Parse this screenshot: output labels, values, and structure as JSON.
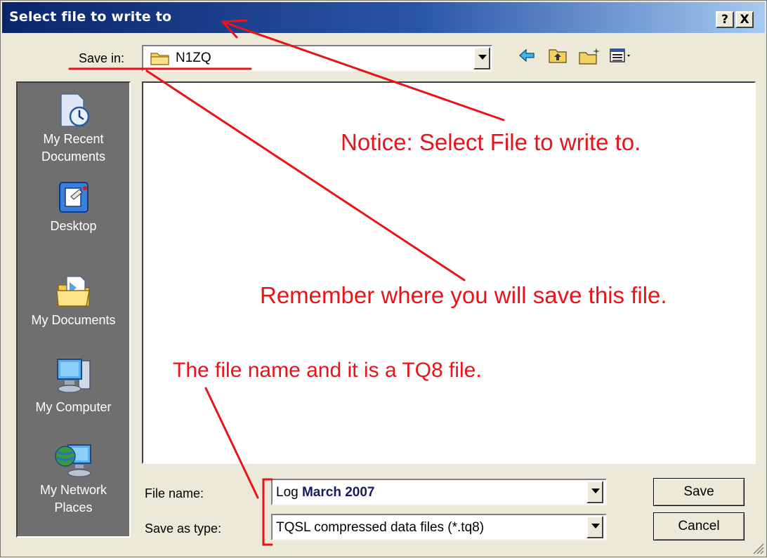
{
  "window": {
    "title": "Select file to write to",
    "help_button": "?",
    "close_button": "X"
  },
  "save_in": {
    "label": "Save in:",
    "value": "N1ZQ"
  },
  "toolbar": {
    "back_icon": "back-arrow-icon",
    "up_icon": "up-folder-icon",
    "new_folder_icon": "new-folder-icon",
    "view_icon": "view-menu-icon"
  },
  "places": [
    {
      "label_line1": "My Recent",
      "label_line2": "Documents",
      "icon": "recent-documents-icon"
    },
    {
      "label_line1": "Desktop",
      "label_line2": "",
      "icon": "desktop-icon"
    },
    {
      "label_line1": "My Documents",
      "label_line2": "",
      "icon": "my-documents-icon"
    },
    {
      "label_line1": "My Computer",
      "label_line2": "",
      "icon": "my-computer-icon"
    },
    {
      "label_line1": "My Network",
      "label_line2": "Places",
      "icon": "network-places-icon"
    }
  ],
  "file_name": {
    "label": "File name:",
    "value_prefix": "Log ",
    "value_highlight": "March 2007"
  },
  "save_as_type": {
    "label": "Save as type:",
    "value": "TQSL compressed data files (*.tq8)"
  },
  "buttons": {
    "save": "Save",
    "cancel": "Cancel"
  },
  "annotations": {
    "notice": "Notice: Select File to write to.",
    "remember": "Remember where you will save this file.",
    "filename_note": "The file name and it is a TQ8 file.",
    "color": "#e8141a"
  }
}
